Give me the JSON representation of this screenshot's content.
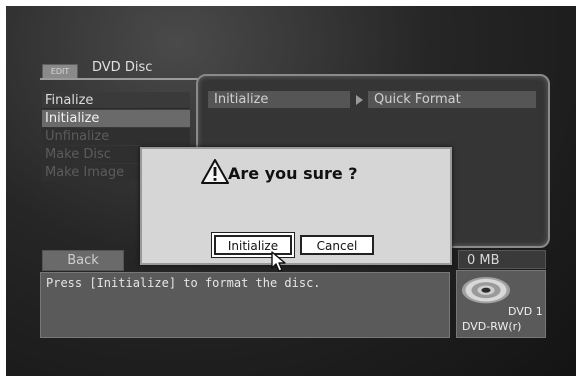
{
  "tab": {
    "label": "EDIT",
    "title": "DVD Disc"
  },
  "menu": {
    "items": [
      {
        "label": "Finalize",
        "state": "normal"
      },
      {
        "label": "Initialize",
        "state": "selected"
      },
      {
        "label": "Unfinalize",
        "state": "disabled"
      },
      {
        "label": "Make Disc",
        "state": "disabled"
      },
      {
        "label": "Make Image",
        "state": "disabled"
      }
    ]
  },
  "panel": {
    "header_left": "Initialize",
    "header_right": "Quick Format"
  },
  "bottom": {
    "back_label": "Back",
    "size": "0 MB",
    "message": "Press [Initialize] to format the disc."
  },
  "disc": {
    "name": "DVD 1",
    "type": "DVD-RW(r)"
  },
  "dialog": {
    "title": "Are you sure ?",
    "ok_label": "Initialize",
    "cancel_label": "Cancel",
    "icon": "warning-icon"
  },
  "colors": {
    "background": "#1c1c1c",
    "dialog": "#d6d6d6",
    "selected": "#6a6a6a"
  }
}
